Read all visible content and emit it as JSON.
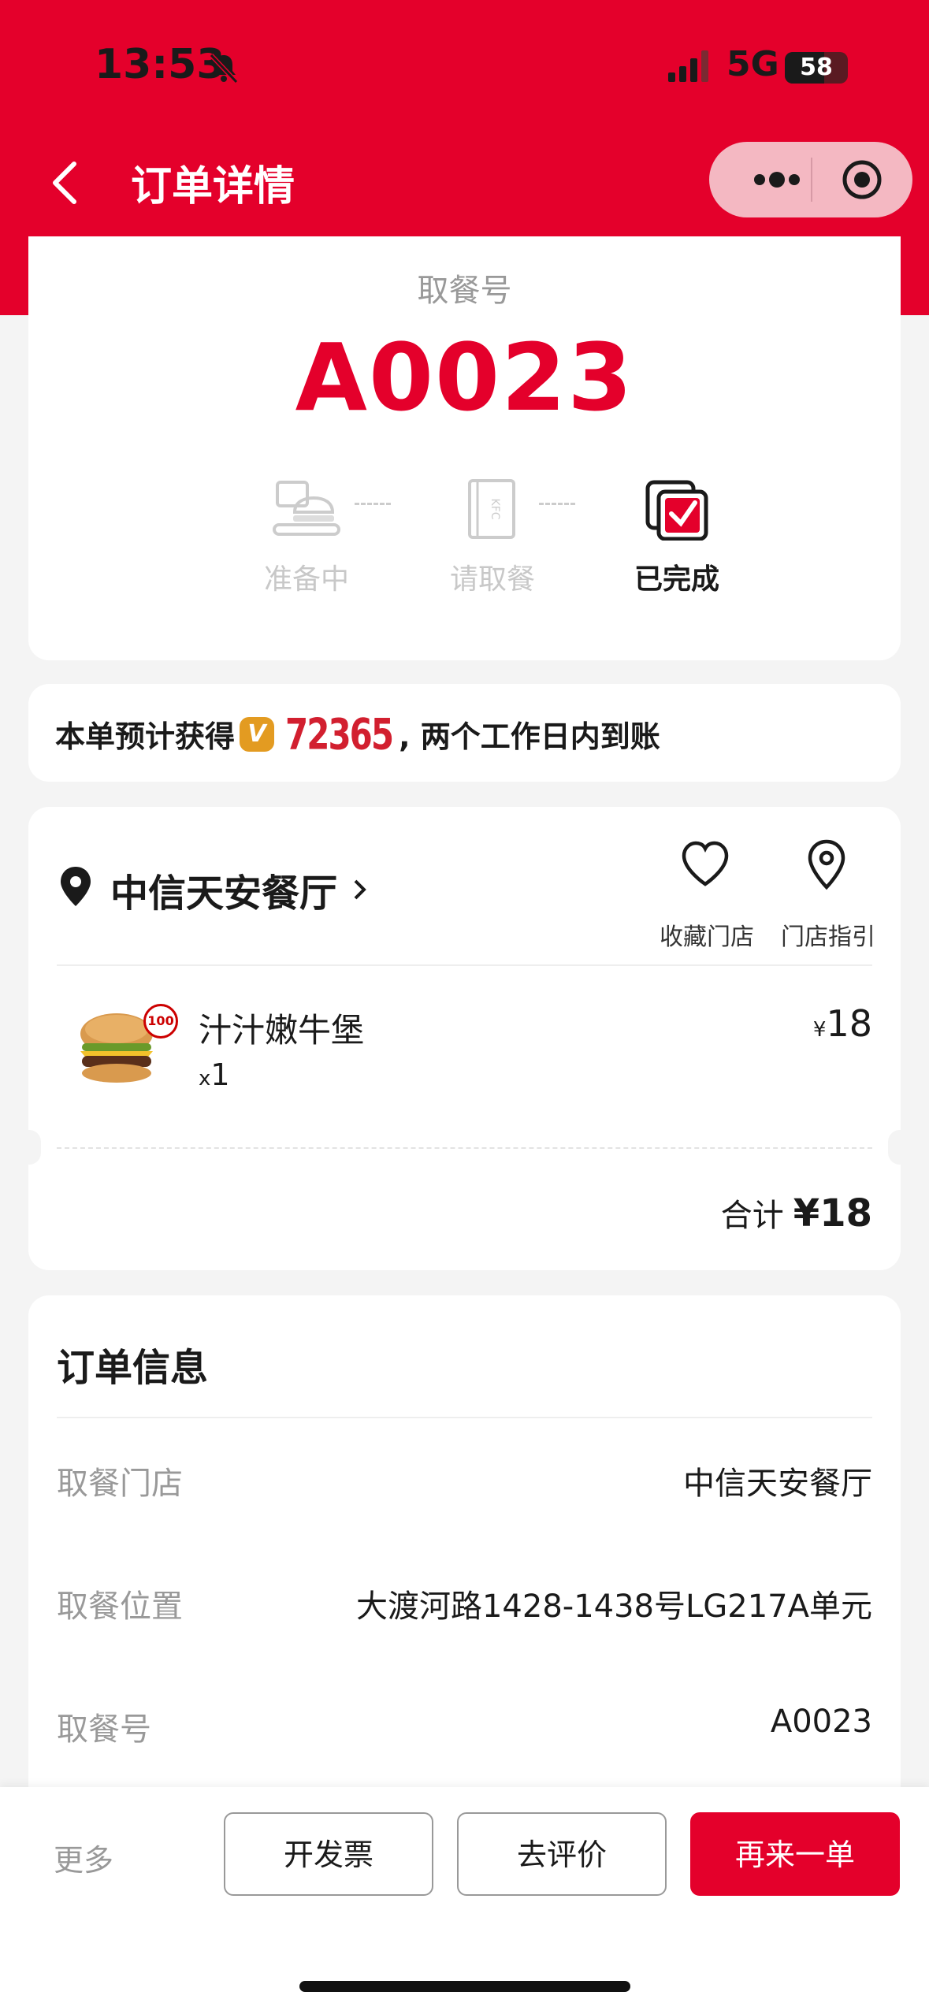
{
  "status": {
    "time": "13:53",
    "network": "5G",
    "battery": "58"
  },
  "nav": {
    "title": "订单详情"
  },
  "pickup": {
    "label": "取餐号",
    "number": "A0023",
    "steps": [
      {
        "label": "准备中",
        "icon": "tray-icon",
        "state": "inactive"
      },
      {
        "label": "请取餐",
        "icon": "bag-icon",
        "state": "inactive"
      },
      {
        "label": "已完成",
        "icon": "check-bag-icon",
        "state": "done"
      }
    ]
  },
  "earn": {
    "prefix": "本单预计获得",
    "points": "72365",
    "suffix": ", 两个工作日内到账",
    "badge": "V"
  },
  "store": {
    "name": "中信天安餐厅",
    "favorite_label": "收藏门店",
    "guide_label": "门店指引"
  },
  "item": {
    "name": "汁汁嫩牛堡",
    "qty_prefix": "x",
    "qty": "1",
    "currency": "¥",
    "price": "18",
    "badge": "100"
  },
  "total": {
    "label": "合计",
    "value": "¥18"
  },
  "info": {
    "title": "订单信息",
    "rows": [
      {
        "key": "取餐门店",
        "value": "中信天安餐厅"
      },
      {
        "key": "取餐位置",
        "value": "大渡河路1428-1438号LG217A单元"
      },
      {
        "key": "取餐号",
        "value": "A0023"
      }
    ]
  },
  "actions": {
    "more": "更多",
    "invoice": "开发票",
    "review": "去评价",
    "reorder": "再来一单"
  },
  "colors": {
    "brand": "#e4002b",
    "gold": "#e39b21"
  }
}
